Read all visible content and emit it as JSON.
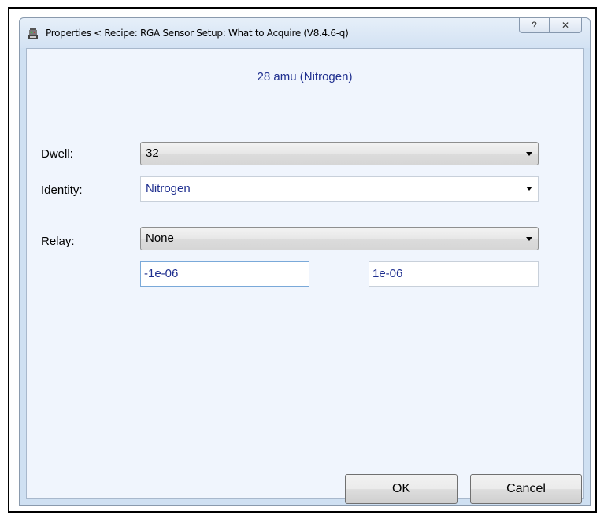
{
  "window": {
    "title": "Properties < Recipe: RGA Sensor Setup: What to Acquire  (V8.4.6-q)",
    "help_glyph": "?",
    "close_glyph": "✕"
  },
  "form": {
    "heading": "28 amu (Nitrogen)",
    "dwell": {
      "label": "Dwell:",
      "value": "32"
    },
    "identity": {
      "label": "Identity:",
      "value": "Nitrogen"
    },
    "relay": {
      "label": "Relay:",
      "value": "None"
    },
    "range_low": "-1e-06",
    "range_high": "1e-06"
  },
  "buttons": {
    "ok": "OK",
    "cancel": "Cancel"
  },
  "colors": {
    "value_text": "#1f2f8f",
    "client_bg": "#f0f5fd",
    "frame_bg": "#cfe0f2"
  }
}
